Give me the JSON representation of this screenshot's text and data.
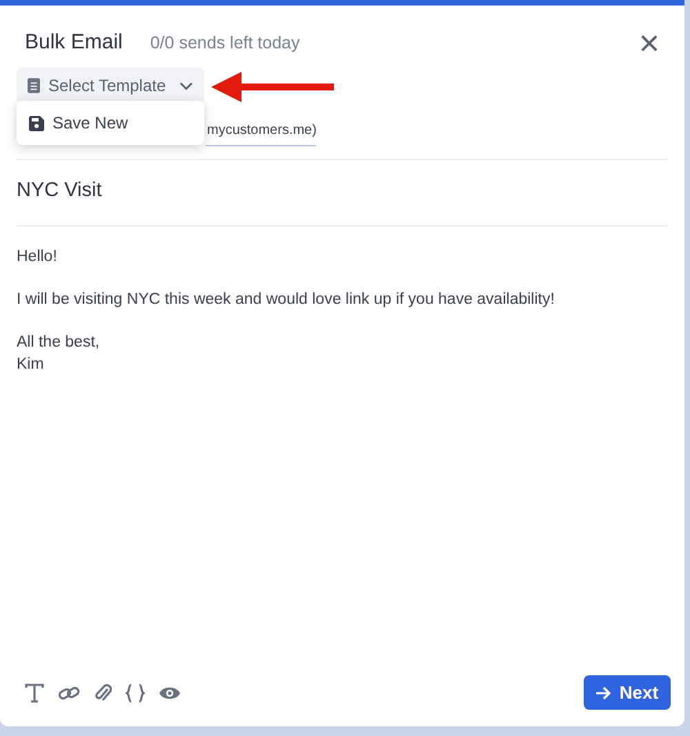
{
  "header": {
    "title": "Bulk Email",
    "quota": "0/0 sends left today",
    "close": "×"
  },
  "template_button": {
    "label": "Select Template",
    "expanded": true
  },
  "template_menu": [
    {
      "label": "Save New"
    }
  ],
  "from_field": {
    "value": "mycustomers.me)"
  },
  "subject": "NYC Visit",
  "body": [
    "Hello!",
    "I will be visiting NYC this week and would love link up if you have availability!",
    "All the best,\nKim"
  ],
  "toolbar": [
    {
      "kind": "text"
    },
    {
      "kind": "link"
    },
    {
      "kind": "attach"
    },
    {
      "kind": "braces"
    },
    {
      "kind": "eye"
    }
  ],
  "next_button": {
    "label": "Next"
  }
}
